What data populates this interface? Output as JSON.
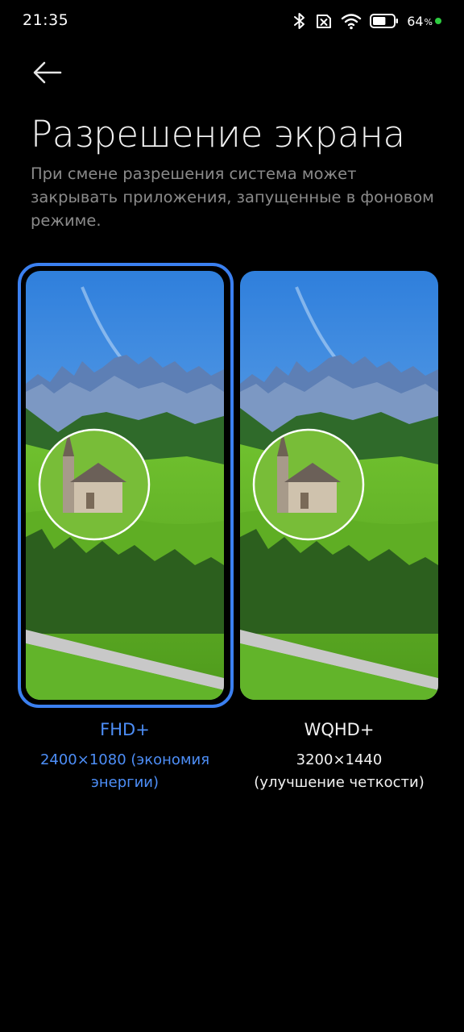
{
  "status_bar": {
    "time": "21:35",
    "battery_percent": "64",
    "battery_percent_sign": "%",
    "icons": [
      "bluetooth-icon",
      "sim-crossed-icon",
      "wifi-icon",
      "battery-icon",
      "charging-dot-icon"
    ],
    "battery_level": 0.64,
    "charging_color": "#2ecc40"
  },
  "header": {
    "back_icon": "arrow-left-icon",
    "title": "Разрешение экрана",
    "description": "При смене разрешения система может закрывать приложения, запущенные в фоновом режиме."
  },
  "options": [
    {
      "title": "FHD+",
      "detail_line1": "2400×1080 (экономия",
      "detail_line2": "энергии)",
      "selected": true
    },
    {
      "title": "WQHD+",
      "detail_line1": "3200×1440",
      "detail_line2": "(улучшение четкости)",
      "selected": false
    }
  ],
  "colors": {
    "accent": "#3b80f0",
    "accent_text": "#4d8ef7",
    "background": "#000000",
    "description_text": "#8a8a8a"
  }
}
